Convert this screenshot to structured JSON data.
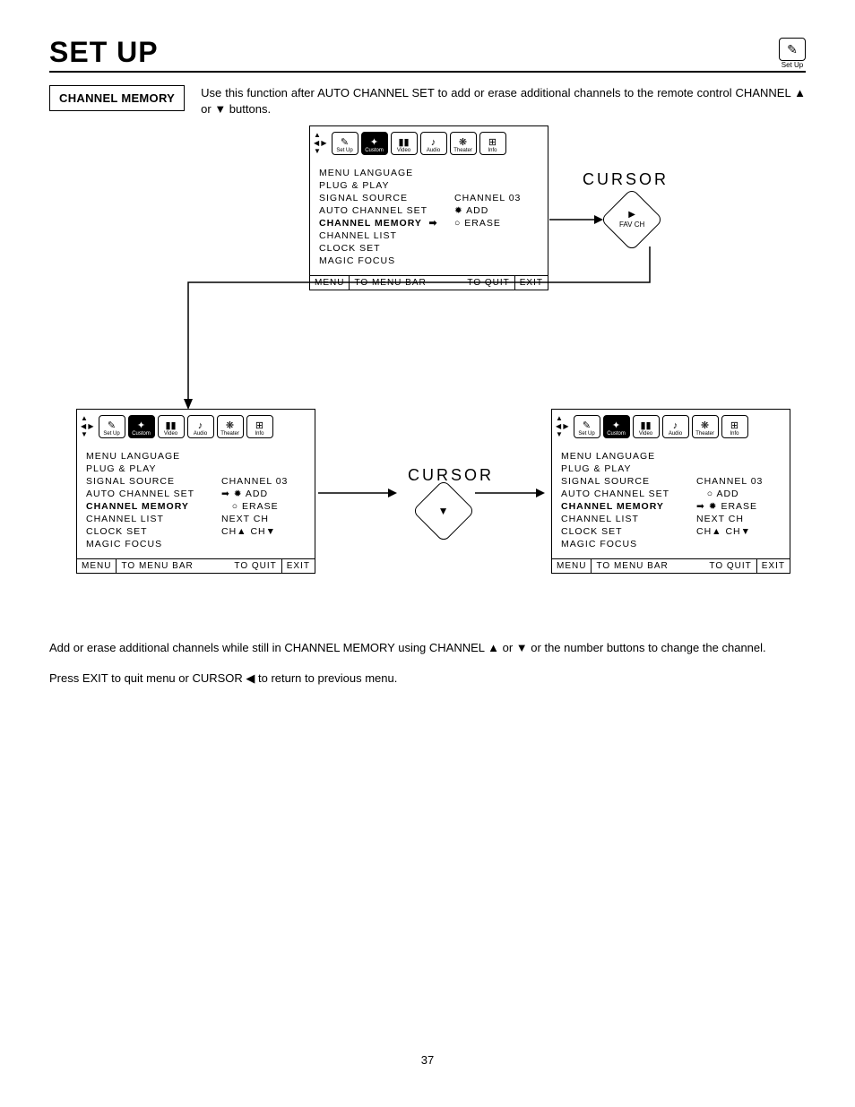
{
  "header": {
    "title": "SET UP",
    "corner_icon": "✎",
    "corner_label": "Set Up"
  },
  "section": {
    "box_label": "CHANNEL MEMORY",
    "intro": "Use this function after AUTO CHANNEL SET to add or erase additional channels to the remote control CHANNEL ▲ or ▼ buttons."
  },
  "tabs": {
    "setup": "Set Up",
    "custom": "Custom",
    "video": "Video",
    "audio": "Audio",
    "theater": "Theater",
    "info": "Info"
  },
  "menu_items": {
    "lang": "MENU LANGUAGE",
    "plug": "PLUG & PLAY",
    "signal": "SIGNAL SOURCE",
    "auto": "AUTO CHANNEL SET",
    "chmem": "CHANNEL MEMORY",
    "chlist": "CHANNEL LIST",
    "clock": "CLOCK SET",
    "magic": "MAGIC FOCUS"
  },
  "r": {
    "channel": "CHANNEL  03",
    "add": "ADD",
    "erase": "ERASE",
    "next": "NEXT CH",
    "chnav": "CH▲  CH▼"
  },
  "foot": {
    "menu": "MENU",
    "tomenu": "TO MENU BAR",
    "toquit": "TO QUIT",
    "exit": "EXIT"
  },
  "cursor": {
    "label": "CURSOR",
    "right": "▶",
    "fav": "FAV CH",
    "down": "▼"
  },
  "closing": {
    "p1": "Add or erase additional channels while still in CHANNEL MEMORY using CHANNEL ▲ or ▼ or the number buttons to change the channel.",
    "p2": "Press EXIT to quit menu or CURSOR ◀ to return to previous menu."
  },
  "page": "37"
}
